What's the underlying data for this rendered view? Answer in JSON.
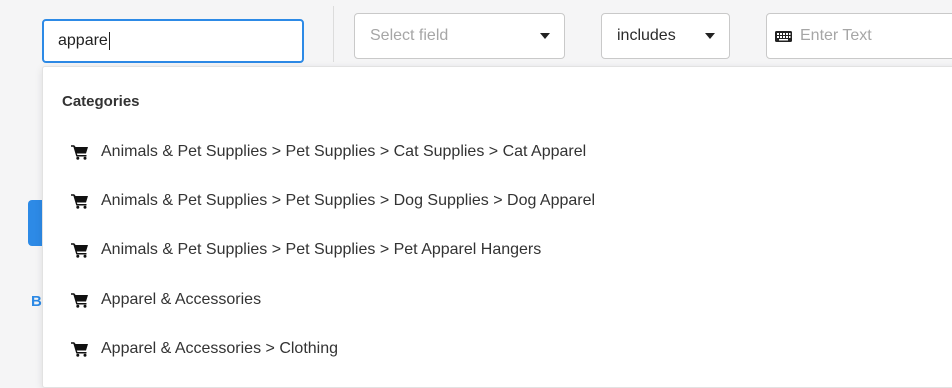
{
  "search": {
    "value": "appare"
  },
  "field_select": {
    "placeholder": "Select field"
  },
  "operator_select": {
    "value": "includes"
  },
  "text_input": {
    "placeholder": "Enter Text"
  },
  "left_panel": {
    "link_text_fragment": "Be"
  },
  "dropdown": {
    "heading": "Categories",
    "options": [
      {
        "label": "Animals & Pet Supplies > Pet Supplies > Cat Supplies > Cat Apparel",
        "icon": "cart-icon"
      },
      {
        "label": "Animals & Pet Supplies > Pet Supplies > Dog Supplies > Dog Apparel",
        "icon": "cart-icon"
      },
      {
        "label": "Animals & Pet Supplies > Pet Supplies > Pet Apparel Hangers",
        "icon": "cart-icon"
      },
      {
        "label": "Apparel & Accessories",
        "icon": "cart-icon"
      },
      {
        "label": "Apparel & Accessories > Clothing",
        "icon": "cart-icon"
      }
    ]
  },
  "colors": {
    "accent": "#2d8ae6",
    "border": "#c9c9c9",
    "background": "#f5f5f6"
  }
}
